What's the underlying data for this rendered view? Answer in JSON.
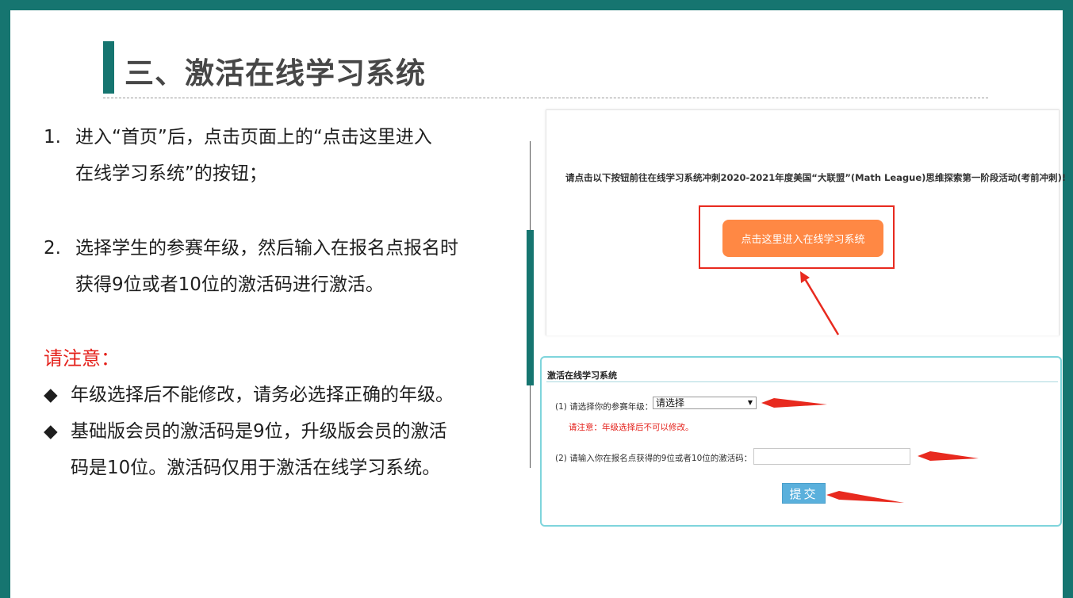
{
  "slide": {
    "title": "三、激活在线学习系统",
    "steps": [
      {
        "num": "1.",
        "lines": [
          "进入“首页”后，点击页面上的“点击这里进入",
          "在线学习系统”的按钮；"
        ]
      },
      {
        "num": "2.",
        "lines": [
          "选择学生的参赛年级，然后输入在报名点报名时",
          "获得9位或者10位的激活码进行激活。"
        ]
      }
    ],
    "notice_heading": "请注意：",
    "bullets": [
      {
        "mark": "◆",
        "lines": [
          "年级选择后不能修改，请务必选择正确的年级。"
        ]
      },
      {
        "mark": "◆",
        "lines": [
          "基础版会员的激活码是9位，升级版会员的激活",
          "码是10位。激活码仅用于激活在线学习系统。"
        ]
      }
    ]
  },
  "screenshot_home": {
    "prompt": "请点击以下按钮前往在线学习系统冲刺2020-2021年度美国“大联盟”(Math League)思维探索第一阶段活动(考前冲刺)!",
    "enter_button": "点击这里进入在线学习系统"
  },
  "screenshot_activate": {
    "title": "激活在线学习系统",
    "grade_label": "(1) 请选择你的参赛年级：",
    "grade_value": "请选择",
    "grade_warning": "请注意：年级选择后不可以修改。",
    "code_label": "(2) 请输入你在报名点获得的9位或者10位的激活码：",
    "code_value": "",
    "submit_label": "提交"
  },
  "colors": {
    "frame": "#167570",
    "title_text": "#474747",
    "notice_red": "#e4211b",
    "enter_button": "#ff8844",
    "submit_button": "#5ab0dc",
    "annotation_red": "#e82a1f"
  }
}
